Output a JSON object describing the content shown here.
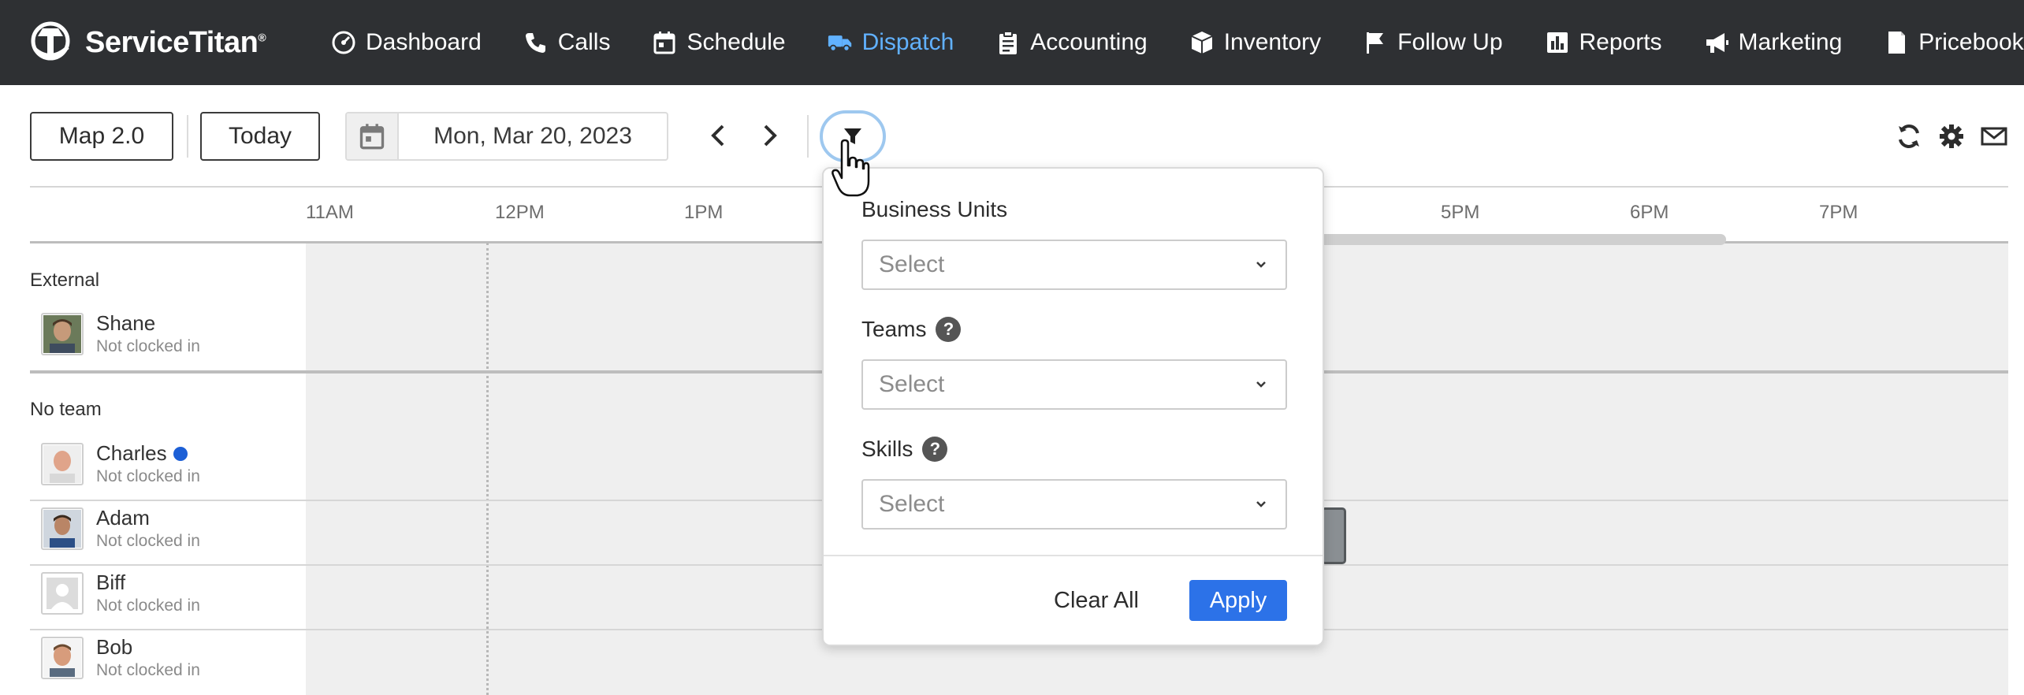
{
  "brand": {
    "name": "ServiceTitan",
    "reg": "®"
  },
  "nav": {
    "items": [
      {
        "label": "Dashboard",
        "icon": "dashboard-gauge-icon"
      },
      {
        "label": "Calls",
        "icon": "phone-icon"
      },
      {
        "label": "Schedule",
        "icon": "calendar-icon"
      },
      {
        "label": "Dispatch",
        "icon": "truck-icon",
        "active": true
      },
      {
        "label": "Accounting",
        "icon": "clipboard-icon"
      },
      {
        "label": "Inventory",
        "icon": "box-icon"
      },
      {
        "label": "Follow Up",
        "icon": "flag-icon"
      },
      {
        "label": "Reports",
        "icon": "bar-chart-icon"
      },
      {
        "label": "Marketing",
        "icon": "megaphone-icon"
      },
      {
        "label": "Pricebook",
        "icon": "book-icon"
      }
    ],
    "active_color": "#61b1ff"
  },
  "toolbar": {
    "map_label": "Map 2.0",
    "today_label": "Today",
    "date": "Mon, Mar 20, 2023"
  },
  "timeline": {
    "hours": [
      "11AM",
      "12PM",
      "1PM",
      "5PM",
      "6PM",
      "7PM"
    ]
  },
  "groups": {
    "external": {
      "title": "External",
      "techs": [
        {
          "name": "Shane",
          "status": "Not clocked in"
        }
      ]
    },
    "no_team": {
      "title": "No team",
      "techs": [
        {
          "name": "Charles",
          "status": "Not clocked in",
          "online_dot": true
        },
        {
          "name": "Adam",
          "status": "Not clocked in"
        },
        {
          "name": "Biff",
          "status": "Not clocked in"
        },
        {
          "name": "Bob",
          "status": "Not clocked in"
        }
      ]
    }
  },
  "filter": {
    "business_units_label": "Business Units",
    "teams_label": "Teams",
    "skills_label": "Skills",
    "select_placeholder": "Select",
    "clear_label": "Clear All",
    "apply_label": "Apply",
    "apply_color": "#2c72e8"
  }
}
